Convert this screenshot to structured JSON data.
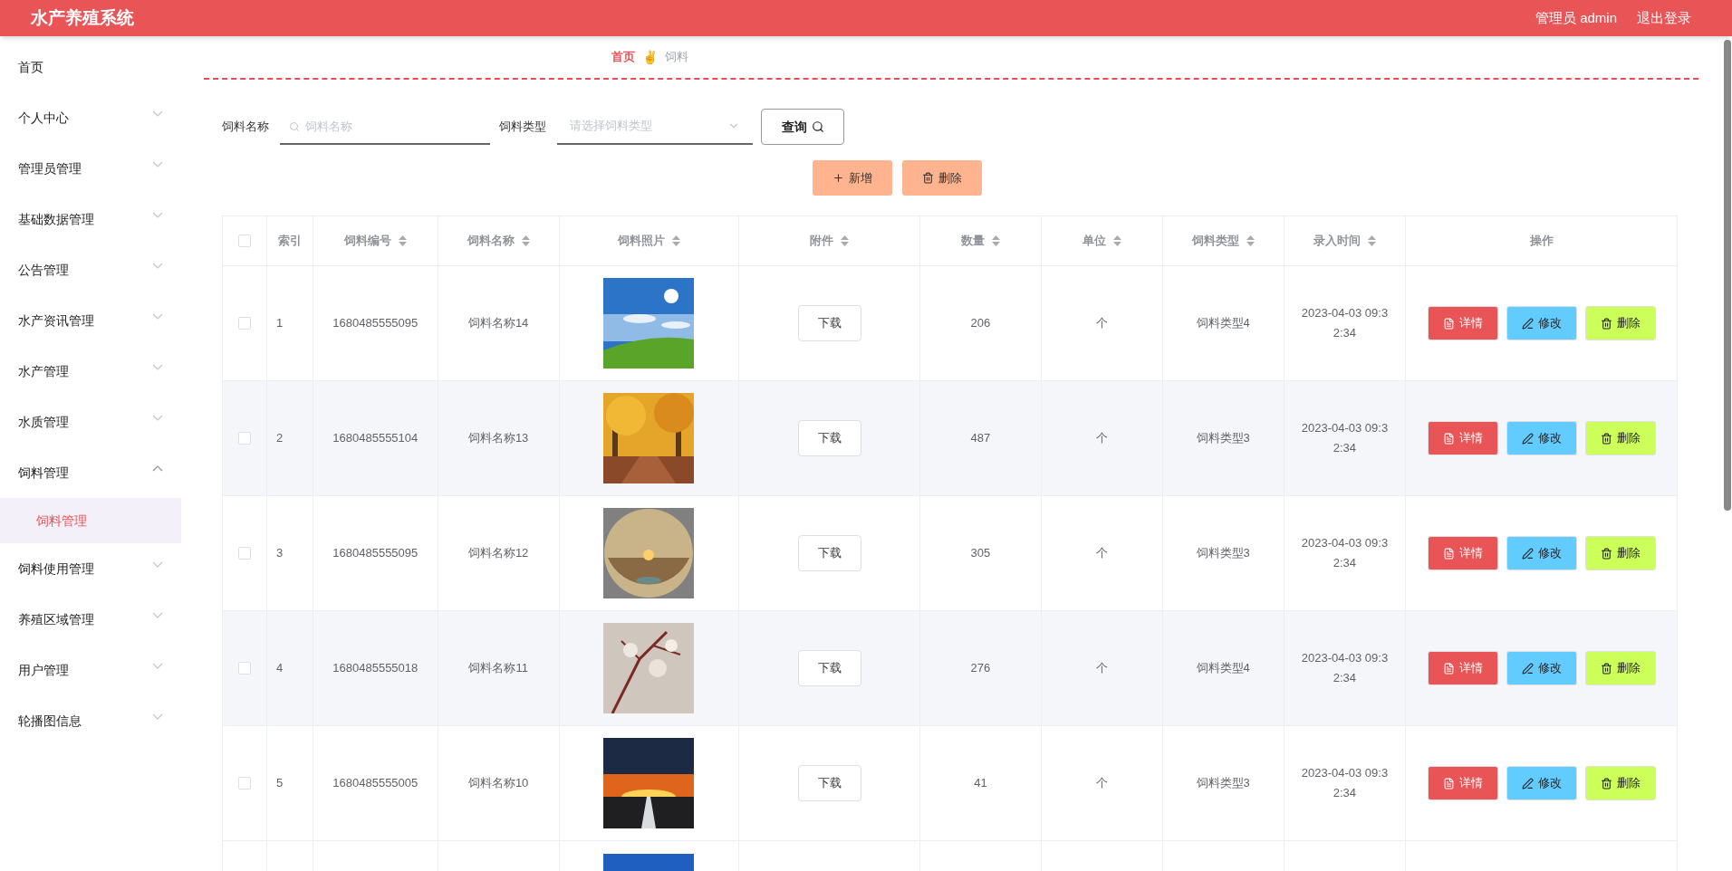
{
  "header": {
    "title": "水产养殖系统",
    "user": "管理员 admin",
    "logout": "退出登录"
  },
  "sidebar": {
    "items": [
      {
        "label": "首页"
      },
      {
        "label": "个人中心",
        "expanded": false
      },
      {
        "label": "管理员管理",
        "expanded": false
      },
      {
        "label": "基础数据管理",
        "expanded": false
      },
      {
        "label": "公告管理",
        "expanded": false
      },
      {
        "label": "水产资讯管理",
        "expanded": false
      },
      {
        "label": "水产管理",
        "expanded": false
      },
      {
        "label": "水质管理",
        "expanded": false
      },
      {
        "label": "饲料管理",
        "expanded": true,
        "children": [
          {
            "label": "饲料管理",
            "selected": true
          }
        ]
      },
      {
        "label": "饲料使用管理",
        "expanded": false
      },
      {
        "label": "养殖区域管理",
        "expanded": false
      },
      {
        "label": "用户管理",
        "expanded": false
      },
      {
        "label": "轮播图信息",
        "expanded": false
      }
    ]
  },
  "breadcrumb_separator": "✌",
  "breadcrumb": [
    {
      "label": "首页",
      "current": false
    },
    {
      "label": "饲料",
      "current": true
    }
  ],
  "search": {
    "name_label": "饲料名称",
    "name_placeholder": "饲料名称",
    "type_label": "饲料类型",
    "type_placeholder": "请选择饲料类型",
    "query_button": "查询"
  },
  "actions": {
    "add": "新增",
    "delete": "删除"
  },
  "table": {
    "columns": [
      {
        "label": "索引",
        "sortable": false
      },
      {
        "label": "饲料编号",
        "sortable": true
      },
      {
        "label": "饲料名称",
        "sortable": true
      },
      {
        "label": "饲料照片",
        "sortable": true
      },
      {
        "label": "附件",
        "sortable": true
      },
      {
        "label": "数量",
        "sortable": true
      },
      {
        "label": "单位",
        "sortable": true
      },
      {
        "label": "饲料类型",
        "sortable": true
      },
      {
        "label": "录入时间",
        "sortable": true
      },
      {
        "label": "操作",
        "sortable": false
      }
    ],
    "rows": [
      {
        "checked": false,
        "index": "1",
        "code": "1680485555095",
        "name": "饲料名称14",
        "download": "下载",
        "quantity": "206",
        "unit": "个",
        "type": "饲料类型4",
        "time": "2023-04-03 09:32:34",
        "buttons": [
          "详情",
          "修改",
          "删除"
        ]
      },
      {
        "checked": false,
        "index": "2",
        "code": "1680485555104",
        "name": "饲料名称13",
        "download": "下载",
        "quantity": "487",
        "unit": "个",
        "type": "饲料类型3",
        "time": "2023-04-03 09:32:34",
        "buttons": [
          "详情",
          "修改",
          "删除"
        ]
      },
      {
        "checked": false,
        "index": "3",
        "code": "1680485555095",
        "name": "饲料名称12",
        "download": "下载",
        "quantity": "305",
        "unit": "个",
        "type": "饲料类型3",
        "time": "2023-04-03 09:32:34",
        "buttons": [
          "详情",
          "修改",
          "删除"
        ]
      },
      {
        "checked": false,
        "index": "4",
        "code": "1680485555018",
        "name": "饲料名称11",
        "download": "下载",
        "quantity": "276",
        "unit": "个",
        "type": "饲料类型4",
        "time": "2023-04-03 09:32:34",
        "buttons": [
          "详情",
          "修改",
          "删除"
        ]
      },
      {
        "checked": false,
        "index": "5",
        "code": "1680485555005",
        "name": "饲料名称10",
        "download": "下载",
        "quantity": "41",
        "unit": "个",
        "type": "饲料类型3",
        "time": "2023-04-03 09:32:34",
        "buttons": [
          "详情",
          "修改",
          "删除"
        ]
      }
    ],
    "header_checked": false
  }
}
